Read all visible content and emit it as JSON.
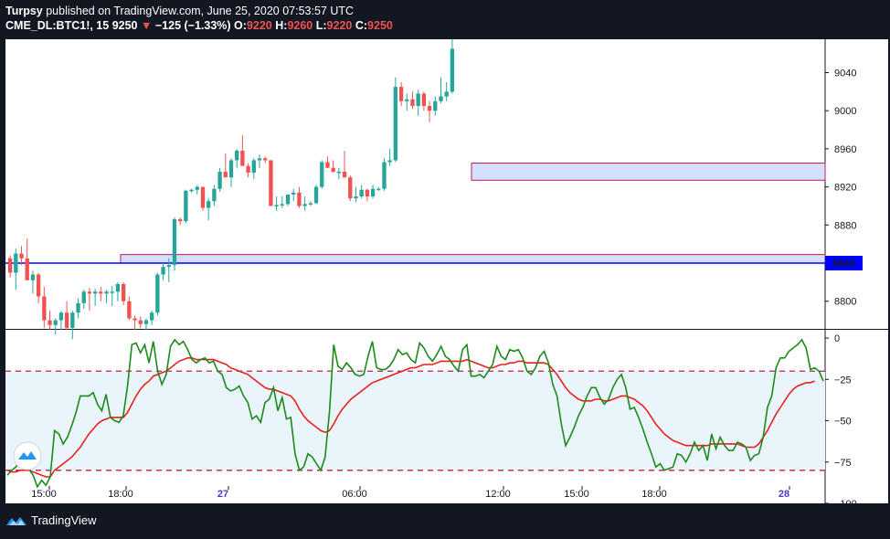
{
  "header": {
    "author": "Turpsy",
    "published": "published on TradingView.com, June 25, 2020 07:53:57 UTC",
    "symbol": "CME_DL:BTC1!, 15",
    "last": "9250",
    "change": "−125 (−1.33%)",
    "o_label": "O:",
    "o_value": "9220",
    "h_label": "H:",
    "h_value": "9260",
    "l_label": "L:",
    "l_value": "9220",
    "c_label": "C:",
    "c_value": "9250"
  },
  "footer": {
    "brand": "TradingView"
  },
  "colors": {
    "up": "#26a69a",
    "down": "#ef5350",
    "osc_main": "#1b8a1b",
    "osc_signal": "#e8201e",
    "level_line": "#0000ff",
    "band_dash": "#b81f4a"
  },
  "chart_data": [
    {
      "type": "candlestick",
      "title": "",
      "ylim": [
        8770,
        9075
      ],
      "y_ticks": [
        "9040",
        "9000",
        "8960",
        "8920",
        "8880",
        "8800"
      ],
      "price_label": "8840",
      "horizontal_line": 8840,
      "zones": [
        {
          "from_time": "18:00",
          "to_time": "end",
          "low": 8840,
          "high": 8849
        },
        {
          "from_time": "10:00",
          "to_time": "end",
          "low": 8927,
          "high": 8945
        }
      ],
      "candles": [
        [
          8845,
          8848,
          8825,
          8830
        ],
        [
          8830,
          8855,
          8812,
          8850
        ],
        [
          8850,
          8858,
          8838,
          8845
        ],
        [
          8845,
          8866,
          8838,
          8822
        ],
        [
          8822,
          8832,
          8808,
          8828
        ],
        [
          8828,
          8830,
          8798,
          8805
        ],
        [
          8805,
          8815,
          8772,
          8780
        ],
        [
          8780,
          8790,
          8770,
          8775
        ],
        [
          8775,
          8782,
          8765,
          8780
        ],
        [
          8780,
          8790,
          8770,
          8788
        ],
        [
          8788,
          8800,
          8770,
          8772
        ],
        [
          8772,
          8790,
          8760,
          8788
        ],
        [
          8788,
          8803,
          8782,
          8798
        ],
        [
          8798,
          8812,
          8792,
          8810
        ],
        [
          8810,
          8814,
          8790,
          8808
        ],
        [
          8808,
          8813,
          8795,
          8810
        ],
        [
          8810,
          8815,
          8800,
          8808
        ],
        [
          8808,
          8812,
          8798,
          8810
        ],
        [
          8810,
          8816,
          8795,
          8810
        ],
        [
          8810,
          8820,
          8800,
          8818
        ],
        [
          8818,
          8820,
          8796,
          8800
        ],
        [
          8800,
          8805,
          8780,
          8782
        ],
        [
          8782,
          8785,
          8770,
          8780
        ],
        [
          8780,
          8784,
          8772,
          8776
        ],
        [
          8776,
          8782,
          8770,
          8780
        ],
        [
          8780,
          8790,
          8775,
          8788
        ],
        [
          8788,
          8830,
          8785,
          8828
        ],
        [
          8828,
          8840,
          8822,
          8836
        ],
        [
          8836,
          8845,
          8820,
          8838
        ],
        [
          8838,
          8888,
          8832,
          8886
        ],
        [
          8886,
          8888,
          8880,
          8884
        ],
        [
          8884,
          8917,
          8882,
          8916
        ],
        [
          8916,
          8918,
          8914,
          8917
        ],
        [
          8917,
          8922,
          8912,
          8920
        ],
        [
          8920,
          8917,
          8895,
          8898
        ],
        [
          8898,
          8908,
          8885,
          8905
        ],
        [
          8905,
          8922,
          8900,
          8918
        ],
        [
          8918,
          8940,
          8915,
          8936
        ],
        [
          8936,
          8955,
          8930,
          8930
        ],
        [
          8930,
          8950,
          8920,
          8948
        ],
        [
          8948,
          8960,
          8940,
          8958
        ],
        [
          8958,
          8974,
          8950,
          8942
        ],
        [
          8942,
          8945,
          8930,
          8935
        ],
        [
          8935,
          8950,
          8928,
          8948
        ],
        [
          8948,
          8954,
          8940,
          8950
        ],
        [
          8950,
          8952,
          8945,
          8948
        ],
        [
          8948,
          8930,
          8900,
          8900
        ],
        [
          8900,
          8910,
          8895,
          8901
        ],
        [
          8901,
          8910,
          8898,
          8902
        ],
        [
          8902,
          8912,
          8900,
          8912
        ],
        [
          8912,
          8918,
          8905,
          8914
        ],
        [
          8914,
          8920,
          8898,
          8900
        ],
        [
          8900,
          8910,
          8895,
          8902
        ],
        [
          8902,
          8905,
          8900,
          8903
        ],
        [
          8903,
          8922,
          8902,
          8920
        ],
        [
          8920,
          8948,
          8918,
          8946
        ],
        [
          8946,
          8952,
          8940,
          8940
        ],
        [
          8940,
          8948,
          8935,
          8936
        ],
        [
          8936,
          8940,
          8928,
          8936
        ],
        [
          8936,
          8958,
          8930,
          8930
        ],
        [
          8930,
          8932,
          8905,
          8908
        ],
        [
          8908,
          8920,
          8904,
          8910
        ],
        [
          8910,
          8922,
          8908,
          8917
        ],
        [
          8917,
          8918,
          8905,
          8910
        ],
        [
          8910,
          8922,
          8908,
          8918
        ],
        [
          8918,
          8920,
          8916,
          8918
        ],
        [
          8918,
          8950,
          8916,
          8946
        ],
        [
          8946,
          8960,
          8942,
          8948
        ],
        [
          8948,
          9035,
          8946,
          9025
        ],
        [
          9025,
          9030,
          9005,
          9010
        ],
        [
          9010,
          9018,
          9000,
          9012
        ],
        [
          9012,
          9020,
          9002,
          9005
        ],
        [
          9005,
          9022,
          8995,
          9018
        ],
        [
          9018,
          9020,
          9000,
          9005
        ],
        [
          9005,
          9010,
          8988,
          9000
        ],
        [
          9000,
          9015,
          8995,
          9010
        ],
        [
          9010,
          9035,
          9008,
          9015
        ],
        [
          9015,
          9030,
          9010,
          9020
        ],
        [
          9020,
          9075,
          9018,
          9065
        ]
      ]
    },
    {
      "type": "line",
      "title": "",
      "ylim": [
        -100,
        5
      ],
      "y_ticks": [
        "0",
        "−25",
        "−50",
        "−75",
        "−100"
      ],
      "bands": [
        -20,
        -80
      ],
      "x_ticks": [
        "15:00",
        "18:00",
        "27",
        "06:00",
        "12:00",
        "15:00",
        "18:00",
        "28"
      ],
      "series": [
        {
          "values": [
            -83,
            -80,
            -78,
            -74,
            -78,
            -79,
            -83,
            -90,
            -86,
            -89,
            -84,
            -56,
            -58,
            -64,
            -60,
            -53,
            -45,
            -35,
            -35,
            -35,
            -33,
            -40,
            -44,
            -34,
            -48,
            -50,
            -51,
            -47,
            -29,
            -4,
            -3,
            -9,
            -4,
            -15,
            -2,
            -20,
            -28,
            -22,
            -5,
            -1,
            -4,
            -2,
            -7,
            -13,
            -15,
            -13,
            -12,
            -15,
            -14,
            -20,
            -22,
            -30,
            -32,
            -31,
            -29,
            -35,
            -39,
            -49,
            -47,
            -51,
            -39,
            -37,
            -30,
            -44,
            -36,
            -49,
            -48,
            -70,
            -80,
            -78,
            -70,
            -72,
            -76,
            -80,
            -72,
            -45,
            -4,
            -17,
            -19,
            -15,
            -18,
            -22,
            -23,
            -22,
            -11,
            -2,
            -18,
            -19,
            -19,
            -17,
            -13,
            -7,
            -10,
            -9,
            -13,
            -15,
            -3,
            -6,
            -11,
            -14,
            -10,
            -5,
            -11,
            -13,
            -17,
            -20,
            -7,
            -4,
            -23,
            -23,
            -22,
            -24,
            -20,
            -16,
            -5,
            -11,
            -13,
            -7,
            -8,
            -7,
            -12,
            -20,
            -22,
            -18,
            -11,
            -8,
            -15,
            -28,
            -35,
            -52,
            -65,
            -60,
            -54,
            -47,
            -42,
            -35,
            -30,
            -30,
            -36,
            -40,
            -37,
            -30,
            -25,
            -22,
            -30,
            -43,
            -42,
            -48,
            -55,
            -63,
            -70,
            -78,
            -76,
            -80,
            -79,
            -78,
            -70,
            -71,
            -75,
            -70,
            -63,
            -68,
            -65,
            -74,
            -58,
            -67,
            -60,
            -65,
            -68,
            -68,
            -63,
            -64,
            -66,
            -74,
            -71,
            -70,
            -60,
            -42,
            -35,
            -18,
            -12,
            -12,
            -8,
            -6,
            -4,
            -1,
            -6,
            -19,
            -18,
            -20,
            -26
          ],
          "signal": [
            -80,
            -81,
            -81,
            -80,
            -80,
            -80,
            -81,
            -82,
            -83,
            -84,
            -84,
            -80,
            -78,
            -76,
            -74,
            -72,
            -69,
            -66,
            -62,
            -58,
            -55,
            -52,
            -50,
            -49,
            -48,
            -48,
            -48,
            -48,
            -45,
            -40,
            -35,
            -31,
            -28,
            -26,
            -23,
            -22,
            -21,
            -20,
            -18,
            -16,
            -14,
            -13,
            -12,
            -12,
            -13,
            -13,
            -13,
            -13,
            -13,
            -14,
            -15,
            -16,
            -18,
            -19,
            -20,
            -21,
            -22,
            -24,
            -26,
            -28,
            -30,
            -31,
            -31,
            -32,
            -33,
            -34,
            -35,
            -38,
            -43,
            -47,
            -50,
            -52,
            -54,
            -56,
            -57,
            -56,
            -52,
            -47,
            -43,
            -40,
            -37,
            -35,
            -33,
            -31,
            -29,
            -27,
            -26,
            -25,
            -24,
            -23,
            -22,
            -21,
            -20,
            -19,
            -18,
            -18,
            -17,
            -16,
            -16,
            -16,
            -15,
            -14,
            -14,
            -14,
            -14,
            -14,
            -14,
            -13,
            -14,
            -15,
            -16,
            -17,
            -18,
            -18,
            -17,
            -16,
            -16,
            -15,
            -15,
            -14,
            -14,
            -15,
            -15,
            -15,
            -15,
            -15,
            -16,
            -19,
            -22,
            -26,
            -30,
            -33,
            -35,
            -37,
            -38,
            -38,
            -38,
            -37,
            -37,
            -38,
            -38,
            -37,
            -36,
            -35,
            -35,
            -36,
            -37,
            -39,
            -41,
            -44,
            -48,
            -52,
            -55,
            -58,
            -60,
            -62,
            -63,
            -64,
            -65,
            -65,
            -65,
            -65,
            -65,
            -65,
            -64,
            -64,
            -64,
            -64,
            -64,
            -64,
            -64,
            -65,
            -66,
            -66,
            -66,
            -64,
            -60,
            -56,
            -51,
            -46,
            -42,
            -38,
            -34,
            -31,
            -29,
            -28,
            -27,
            -27,
            -26
          ]
        }
      ]
    }
  ]
}
